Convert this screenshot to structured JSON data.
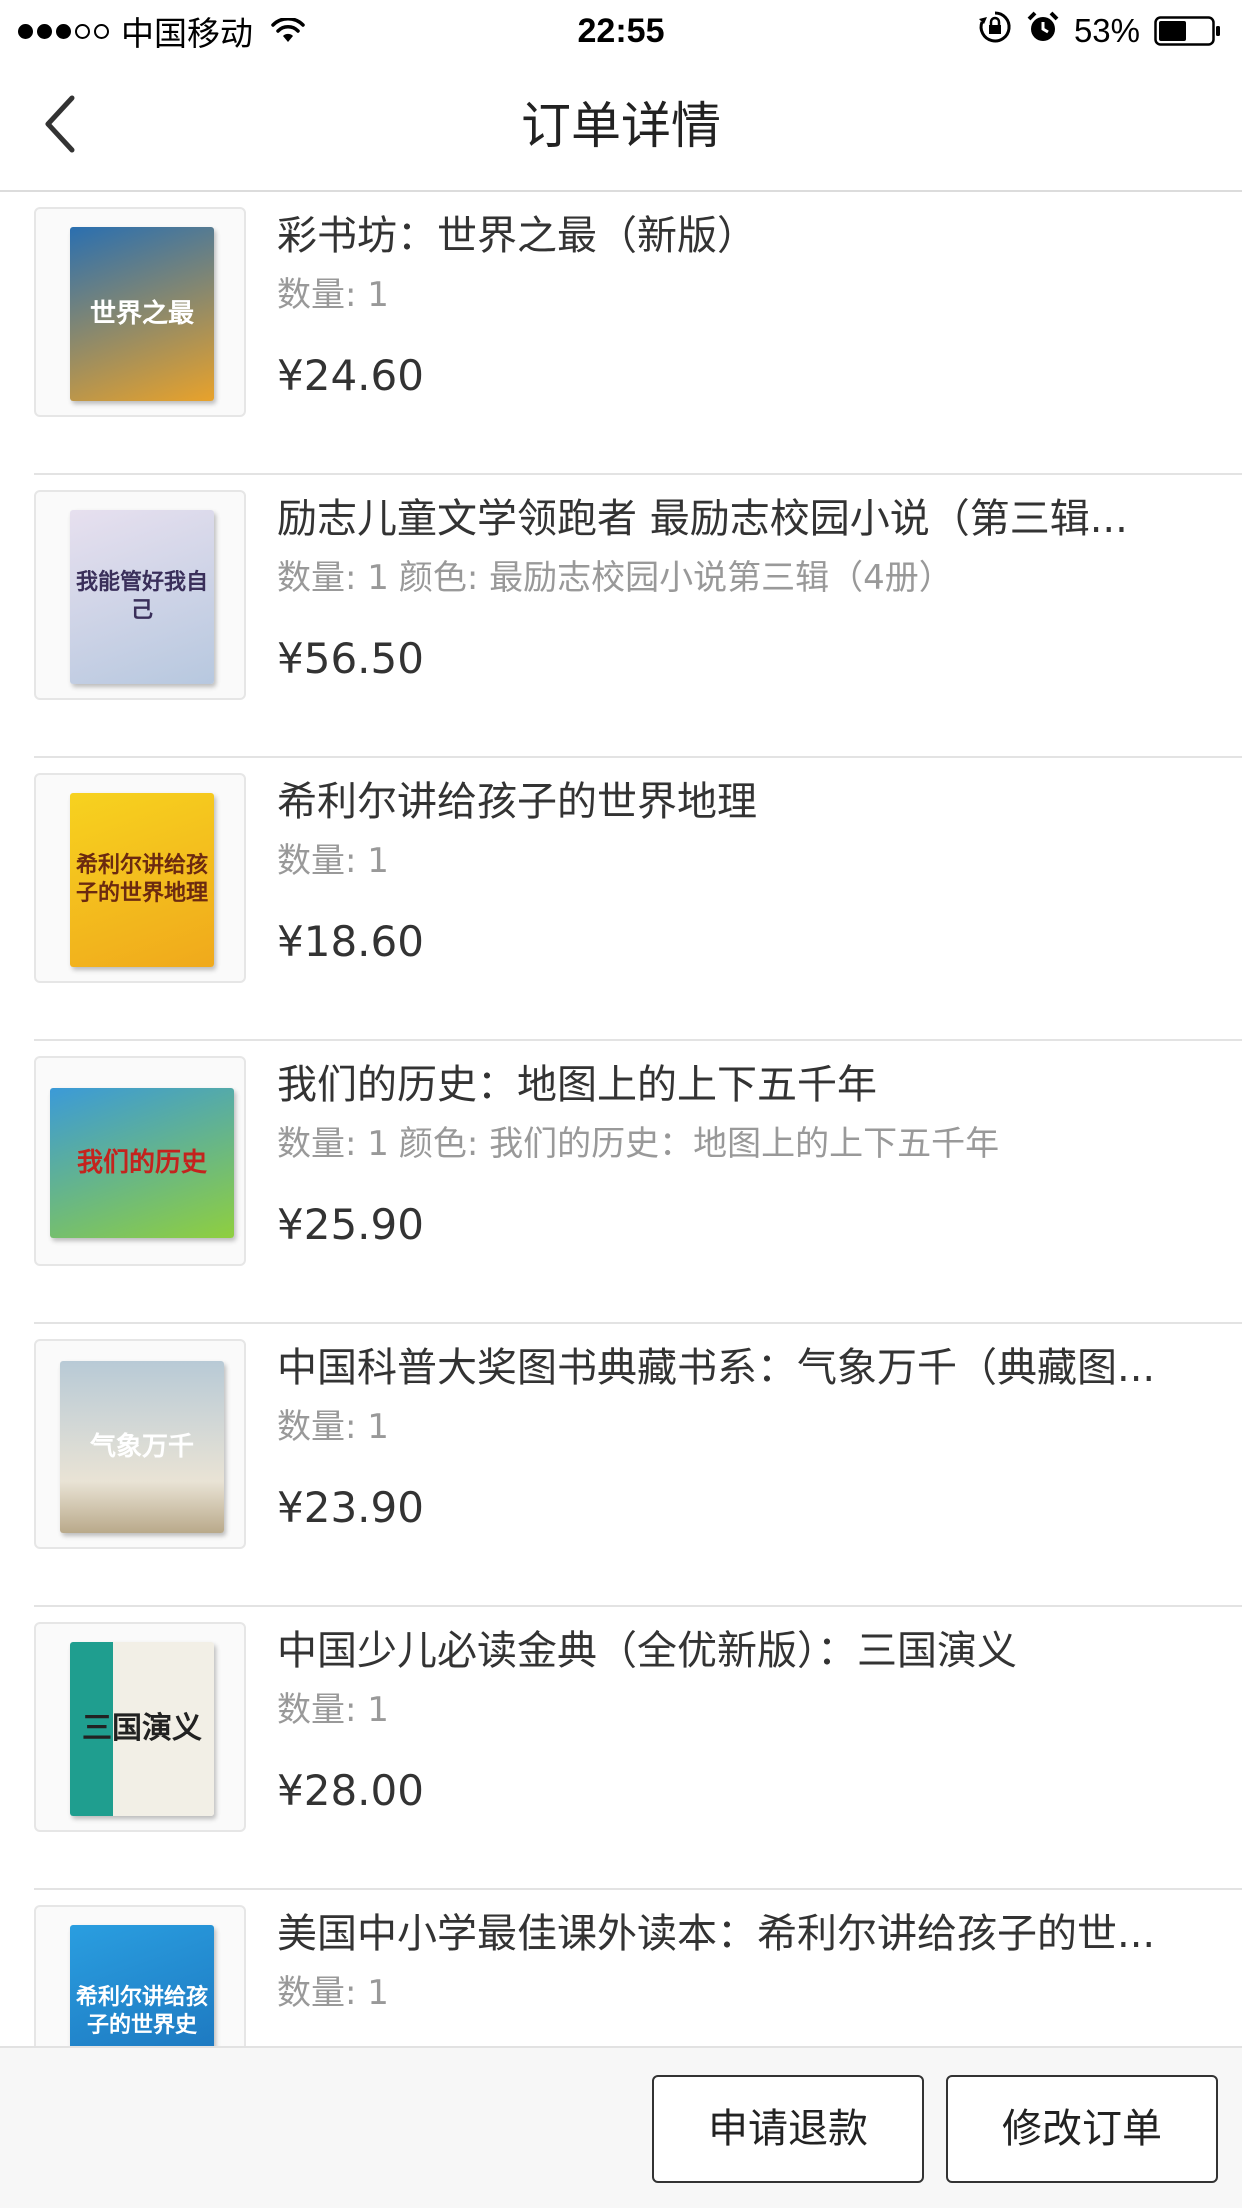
{
  "status_bar": {
    "carrier": "中国移动",
    "time": "22:55",
    "battery_percent": "53%",
    "battery_level": 0.53,
    "signal_bars_filled": 3,
    "signal_bars_total": 5
  },
  "nav": {
    "title": "订单详情",
    "back_icon": "chevron-left-icon"
  },
  "items": [
    {
      "title": "彩书坊：世界之最（新版）",
      "quantity": "数量: 1",
      "color": "",
      "price": "¥24.60",
      "cover_text": "世界之最",
      "cover_color": "#e8a22b"
    },
    {
      "title": "励志儿童文学领跑者 最励志校园小说（第三辑...",
      "quantity": "数量: 1",
      "color": "颜色: 最励志校园小说第三辑（4册）",
      "price": "¥56.50",
      "cover_text": "我能管好我自己",
      "cover_color": "#d8cfe6"
    },
    {
      "title": "希利尔讲给孩子的世界地理",
      "quantity": "数量: 1",
      "color": "",
      "price": "¥18.60",
      "cover_text": "希利尔讲给孩子的世界地理",
      "cover_color": "#f2c21a"
    },
    {
      "title": "我们的历史：地图上的上下五千年",
      "quantity": "数量: 1",
      "color": "颜色: 我们的历史：地图上的上下五千年",
      "price": "¥25.90",
      "cover_text": "我们的历史",
      "cover_color": "#7cc242"
    },
    {
      "title": "中国科普大奖图书典藏书系：气象万千（典藏图...",
      "quantity": "数量: 1",
      "color": "",
      "price": "¥23.90",
      "cover_text": "气象万千",
      "cover_color": "#c9d6df"
    },
    {
      "title": "中国少儿必读金典（全优新版）：三国演义",
      "quantity": "数量: 1",
      "color": "",
      "price": "¥28.00",
      "cover_text": "三国演义",
      "cover_color": "#1f9e8f"
    },
    {
      "title": "美国中小学最佳课外读本：希利尔讲给孩子的世...",
      "quantity": "数量: 1",
      "color": "",
      "price": "",
      "cover_text": "希利尔讲给孩子的世界史",
      "cover_color": "#2a9ee0"
    }
  ],
  "actions": {
    "refund_label": "申请退款",
    "modify_label": "修改订单"
  },
  "colors": {
    "background": "#ffffff",
    "text_primary": "#333333",
    "text_secondary": "#999999",
    "divider": "#e3e3e3",
    "bottom_bar": "#f7f7f7"
  }
}
